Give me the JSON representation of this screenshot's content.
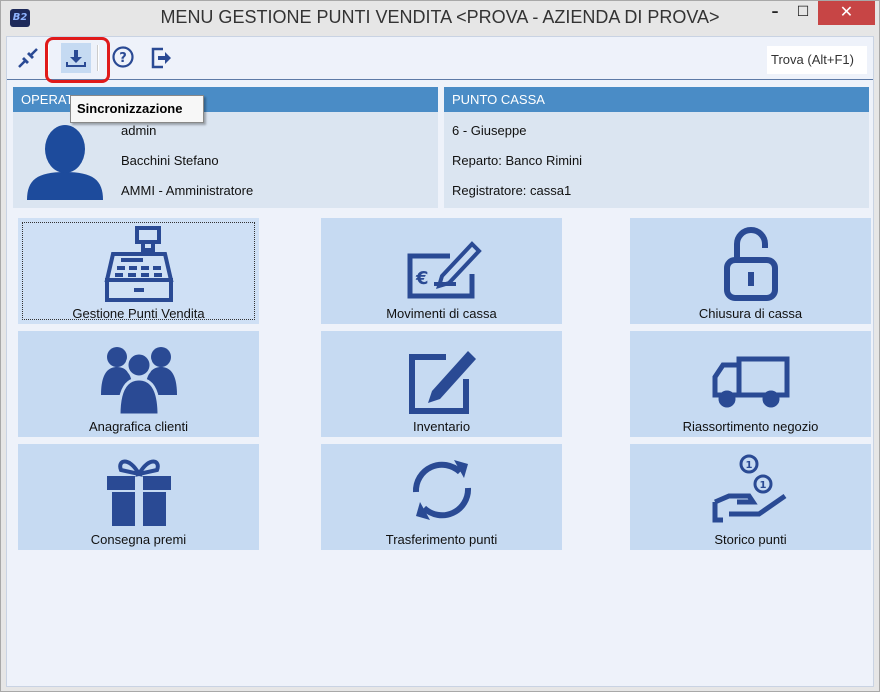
{
  "window": {
    "title": "MENU GESTIONE PUNTI VENDITA <PROVA - AZIENDA DI PROVA>",
    "logo": "B2",
    "minimize": "–",
    "maximize": "☐",
    "close": "✕"
  },
  "toolbar": {
    "items": [
      {
        "icon": "plug-icon"
      },
      {
        "icon": "download-icon",
        "tooltip": "Sincronizzazione",
        "active": true
      },
      {
        "icon": "help-icon"
      },
      {
        "icon": "exit-icon"
      }
    ],
    "find_label": "Trova (Alt+F1)"
  },
  "tooltip": "Sincronizzazione",
  "operator": {
    "header": "OPERATORE",
    "username": "admin",
    "name": "Bacchini Stefano",
    "role": "AMMI - Amministratore"
  },
  "cash_point": {
    "header": "PUNTO CASSA",
    "name": "6 - Giuseppe",
    "department": "Reparto: Banco Rimini",
    "register": "Registratore: cassa1"
  },
  "tiles": [
    {
      "label": "Gestione Punti Vendita",
      "icon": "cash-register-icon"
    },
    {
      "label": "Movimenti di cassa",
      "icon": "euro-check-icon"
    },
    {
      "label": "Chiusura di cassa",
      "icon": "padlock-open-icon"
    },
    {
      "label": "Anagrafica clienti",
      "icon": "people-icon"
    },
    {
      "label": "Inventario",
      "icon": "edit-icon"
    },
    {
      "label": "Riassortimento negozio",
      "icon": "truck-icon"
    },
    {
      "label": "Consegna premi",
      "icon": "gift-icon"
    },
    {
      "label": "Trasferimento punti",
      "icon": "refresh-icon"
    },
    {
      "label": "Storico punti",
      "icon": "coins-hand-icon"
    }
  ],
  "colors": {
    "icon": "#2a4a94",
    "tile": "#c6daf2",
    "header": "#4a8cc6",
    "close": "#c74545"
  }
}
